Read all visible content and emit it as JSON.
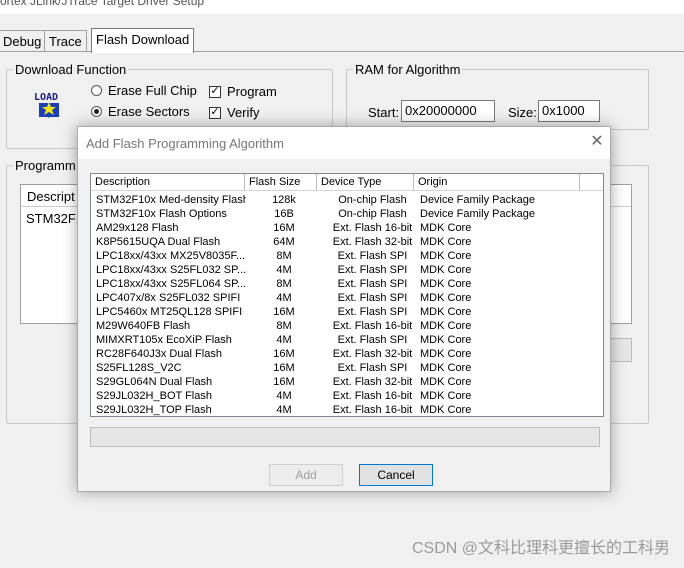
{
  "window": {
    "title": "ortex JLink/JTrace Target Driver Setup"
  },
  "tabs": [
    {
      "label": "Debug"
    },
    {
      "label": "Trace"
    },
    {
      "label": "Flash Download"
    }
  ],
  "download_function": {
    "legend": "Download Function",
    "load_icon_text": "LOAD",
    "erase_full_chip": "Erase Full Chip",
    "erase_sectors": "Erase Sectors",
    "program": "Program",
    "verify": "Verify",
    "selected_erase": "Erase Sectors",
    "program_checked": true,
    "verify_checked": true
  },
  "ram": {
    "legend": "RAM for Algorithm",
    "start_label": "Start:",
    "start_value": "0x20000000",
    "size_label": "Size:",
    "size_value": "0x1000"
  },
  "programming": {
    "legend": "Programm",
    "column_desc": "Descript",
    "row_desc": "STM32F1"
  },
  "dialog": {
    "title": "Add Flash Programming Algorithm",
    "close_glyph": "✕",
    "columns": [
      "Description",
      "Flash Size",
      "Device Type",
      "Origin"
    ],
    "rows": [
      [
        "STM32F10x Med-density Flash",
        "128k",
        "On-chip Flash",
        "Device Family Package"
      ],
      [
        "STM32F10x Flash Options",
        "16B",
        "On-chip Flash",
        "Device Family Package"
      ],
      [
        "AM29x128 Flash",
        "16M",
        "Ext. Flash 16-bit",
        "MDK Core"
      ],
      [
        "K8P5615UQA Dual Flash",
        "64M",
        "Ext. Flash 32-bit",
        "MDK Core"
      ],
      [
        "LPC18xx/43xx MX25V8035F...",
        "8M",
        "Ext. Flash SPI",
        "MDK Core"
      ],
      [
        "LPC18xx/43xx S25FL032 SP...",
        "4M",
        "Ext. Flash SPI",
        "MDK Core"
      ],
      [
        "LPC18xx/43xx S25FL064 SP...",
        "8M",
        "Ext. Flash SPI",
        "MDK Core"
      ],
      [
        "LPC407x/8x S25FL032 SPIFI",
        "4M",
        "Ext. Flash SPI",
        "MDK Core"
      ],
      [
        "LPC5460x MT25QL128 SPIFI",
        "16M",
        "Ext. Flash SPI",
        "MDK Core"
      ],
      [
        "M29W640FB Flash",
        "8M",
        "Ext. Flash 16-bit",
        "MDK Core"
      ],
      [
        "MIMXRT105x EcoXiP Flash",
        "4M",
        "Ext. Flash SPI",
        "MDK Core"
      ],
      [
        "RC28F640J3x Dual Flash",
        "16M",
        "Ext. Flash 32-bit",
        "MDK Core"
      ],
      [
        "S25FL128S_V2C",
        "16M",
        "Ext. Flash SPI",
        "MDK Core"
      ],
      [
        "S29GL064N Dual Flash",
        "16M",
        "Ext. Flash 32-bit",
        "MDK Core"
      ],
      [
        "S29JL032H_BOT Flash",
        "4M",
        "Ext. Flash 16-bit",
        "MDK Core"
      ],
      [
        "S29JL032H_TOP Flash",
        "4M",
        "Ext. Flash 16-bit",
        "MDK Core"
      ]
    ],
    "add_label": "Add",
    "cancel_label": "Cancel"
  },
  "watermark": "CSDN @文科比理科更擅长的工科男",
  "colors": {
    "accent": "#0078d7",
    "dialog_bg": "#f0f0f0",
    "list_bg": "#ffffff"
  }
}
